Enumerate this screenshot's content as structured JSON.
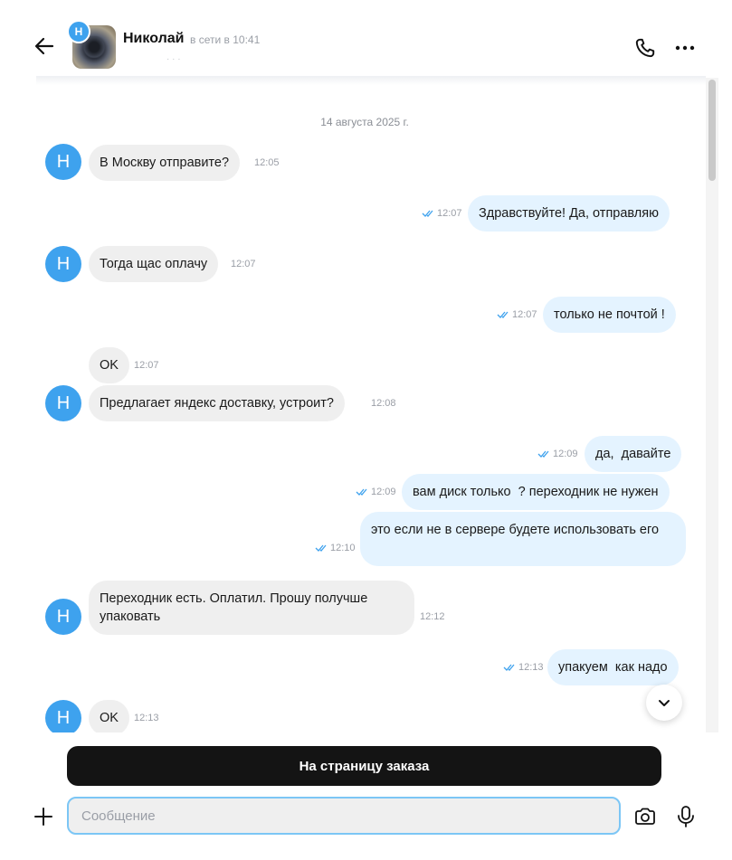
{
  "header": {
    "avatar_letter": "Н",
    "contact_name": "Николай",
    "status": "в сети в 10:41",
    "sub": "· · ·"
  },
  "chat": {
    "date_divider": "14 августа 2025 г.",
    "sender_initial": "Н",
    "messages": [
      {
        "text": "В Москву отправите?",
        "time": "12:05"
      },
      {
        "text": "Здравствуйте! Да, отправляю",
        "time": "12:07"
      },
      {
        "text": "Тогда щас оплачу",
        "time": "12:07"
      },
      {
        "text": "только не почтой !",
        "time": "12:07"
      },
      {
        "text": "OK",
        "time": "12:07"
      },
      {
        "text": "Предлагает яндекс доставку, устроит?",
        "time": "12:08"
      },
      {
        "text": "да,  давайте",
        "time": "12:09"
      },
      {
        "text": "вам диск только  ? переходник не нужен",
        "time": "12:09"
      },
      {
        "text": "это если не в сервере будете использовать его",
        "time": "12:10"
      },
      {
        "text": "Переходник есть. Оплатил. Прошу получше упаковать",
        "time": "12:12"
      },
      {
        "text": "упакуем  как надо",
        "time": "12:13"
      },
      {
        "text": "OK",
        "time": "12:13"
      }
    ]
  },
  "footer": {
    "order_button": "На страницу заказа",
    "input_placeholder": "Сообщение",
    "input_value": ""
  },
  "colors": {
    "accent": "#3ea2ee",
    "outgoing_bubble": "#e4f3ff",
    "incoming_bubble": "#efefef",
    "button_dark": "#141414"
  },
  "icons": [
    "back-arrow-icon",
    "phone-icon",
    "more-icon",
    "double-check-icon",
    "chevron-down-icon",
    "plus-icon",
    "camera-icon",
    "mic-icon"
  ]
}
